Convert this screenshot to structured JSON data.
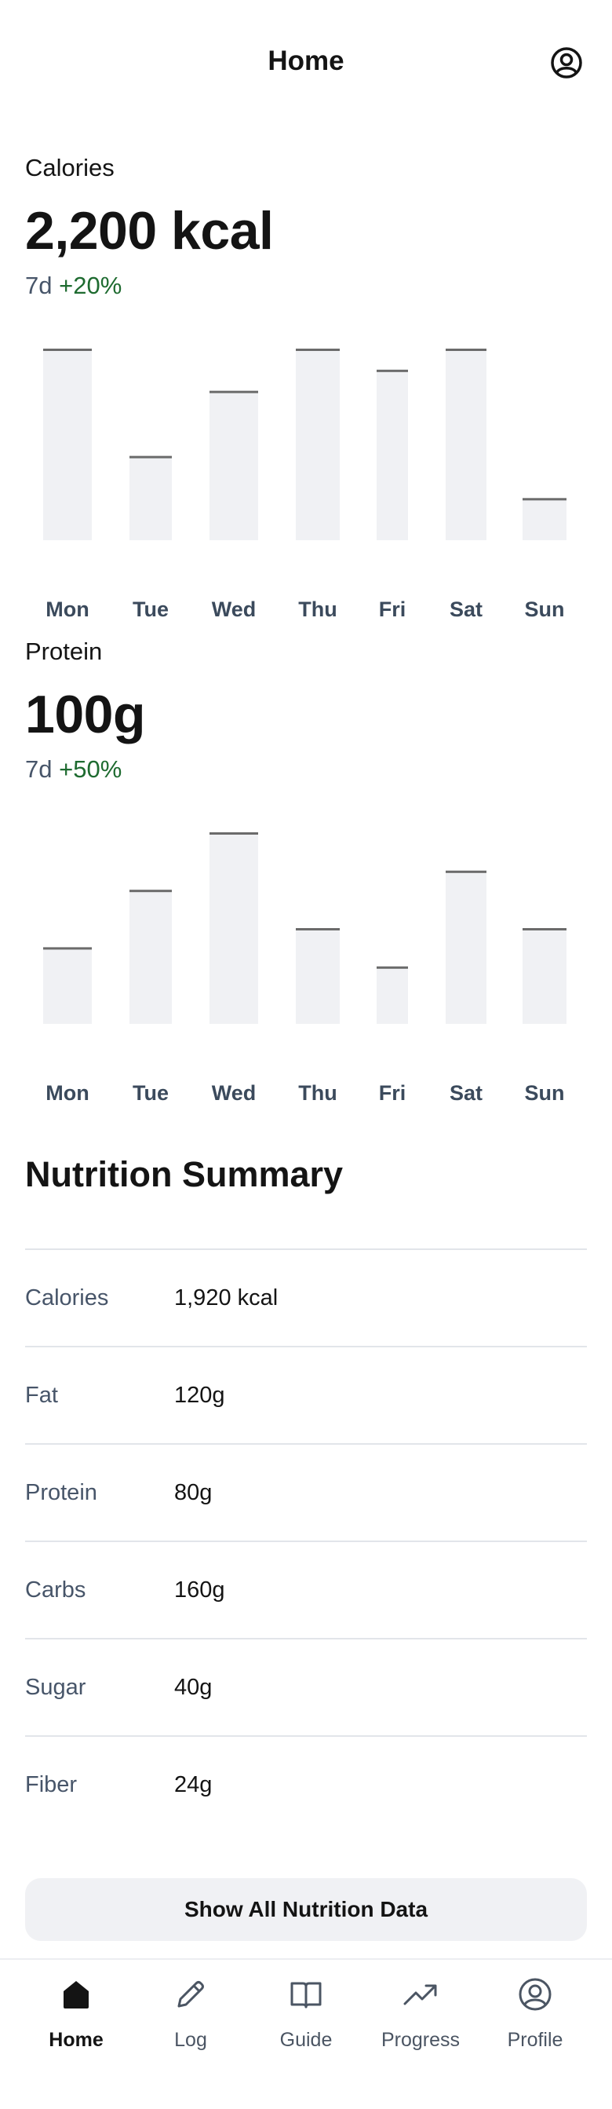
{
  "header": {
    "title": "Home",
    "profile_icon": "user-circle-icon"
  },
  "calories": {
    "label": "Calories",
    "value": "2,200 kcal",
    "period": "7d",
    "change": "+20%"
  },
  "protein": {
    "label": "Protein",
    "value": "100g",
    "period": "7d",
    "change": "+50%"
  },
  "chart_data": [
    {
      "type": "bar",
      "categories": [
        "Mon",
        "Tue",
        "Wed",
        "Thu",
        "Fri",
        "Sat",
        "Sun"
      ],
      "values": [
        100,
        44,
        78,
        100,
        89,
        100,
        22
      ],
      "ylim": [
        0,
        100
      ],
      "colors": {
        "bar": "#f0f1f4",
        "cap": "#6b6b6b"
      }
    },
    {
      "type": "bar",
      "categories": [
        "Mon",
        "Tue",
        "Wed",
        "Thu",
        "Fri",
        "Sat",
        "Sun"
      ],
      "values": [
        40,
        70,
        100,
        50,
        30,
        80,
        50
      ],
      "ylim": [
        0,
        100
      ],
      "colors": {
        "bar": "#f0f1f4",
        "cap": "#6b6b6b"
      }
    }
  ],
  "summary": {
    "title": "Nutrition Summary",
    "rows": [
      {
        "label": "Calories",
        "value": "1,920 kcal"
      },
      {
        "label": "Fat",
        "value": "120g"
      },
      {
        "label": "Protein",
        "value": "80g"
      },
      {
        "label": "Carbs",
        "value": "160g"
      },
      {
        "label": "Sugar",
        "value": "40g"
      },
      {
        "label": "Fiber",
        "value": "24g"
      }
    ],
    "button_label": "Show All Nutrition Data"
  },
  "tabs": [
    {
      "label": "Home",
      "icon": "home-icon",
      "active": true
    },
    {
      "label": "Log",
      "icon": "pencil-icon",
      "active": false
    },
    {
      "label": "Guide",
      "icon": "book-open-icon",
      "active": false
    },
    {
      "label": "Progress",
      "icon": "trending-up-icon",
      "active": false
    },
    {
      "label": "Profile",
      "icon": "user-circle-icon",
      "active": false
    }
  ]
}
